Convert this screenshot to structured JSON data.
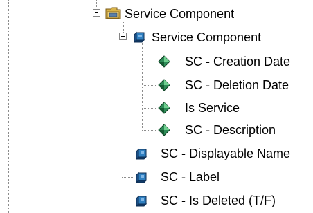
{
  "tree": {
    "nodes": [
      {
        "label": "Service Component",
        "icon": "folder-icon",
        "expanded": true
      },
      {
        "label": "Service Component",
        "icon": "cube-icon",
        "expanded": true
      },
      {
        "label": "SC - Creation Date",
        "icon": "attribute-diamond-icon"
      },
      {
        "label": "SC - Deletion Date",
        "icon": "attribute-diamond-icon"
      },
      {
        "label": "Is Service",
        "icon": "attribute-diamond-icon"
      },
      {
        "label": "SC - Description",
        "icon": "attribute-diamond-icon"
      },
      {
        "label": "SC - Displayable Name",
        "icon": "cube-icon"
      },
      {
        "label": "SC - Label",
        "icon": "cube-icon"
      },
      {
        "label": "SC - Is Deleted (T/F)",
        "icon": "cube-icon"
      }
    ]
  },
  "colors": {
    "background": "#ffffff",
    "connector": "#8c8c8c",
    "folder": "#d9b44a",
    "cube": "#2f7fc0",
    "diamond": "#2e8b57"
  }
}
